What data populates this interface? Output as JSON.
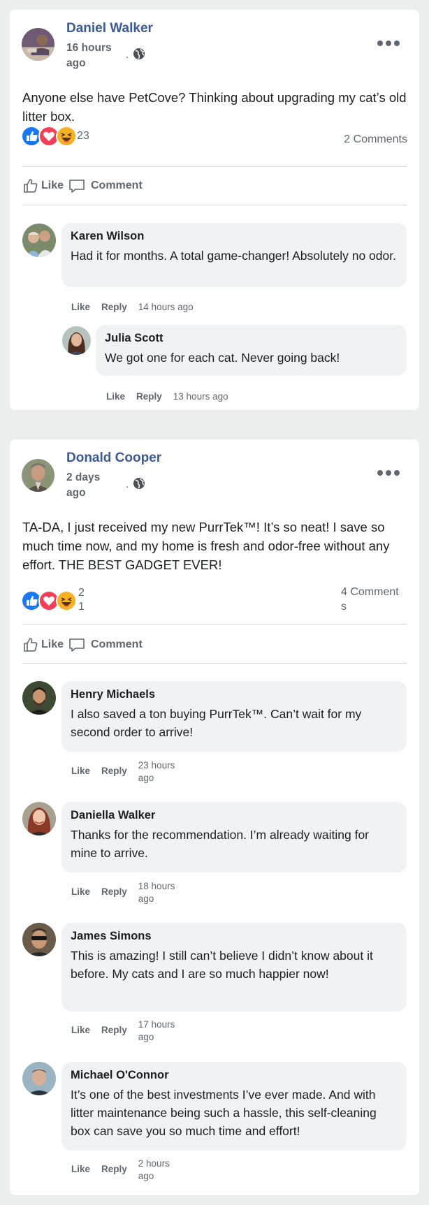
{
  "posts": [
    {
      "author": "Daniel Walker",
      "time": "16 hours ago",
      "separator": ".",
      "text": "Anyone else have PetCove? Thinking about upgrading my cat’s old litter box.",
      "reaction_count": "23",
      "comments_label": "2 Comments",
      "actions": {
        "like": "Like",
        "comment": "Comment"
      },
      "comments": [
        {
          "name": "Karen Wilson",
          "text": "Had it for months. A total game-changer! Absolutely no odor.",
          "like": "Like",
          "reply": "Reply",
          "time": "14 hours ago"
        },
        {
          "name": "Julia Scott",
          "text": "We got one for each cat. Never going back!",
          "like": "Like",
          "reply": "Reply",
          "time": "13 hours ago"
        }
      ]
    },
    {
      "author": "Donald Cooper",
      "time": "2 days ago",
      "separator": ".",
      "text": "TA-DA, I just received my new PurrTek™! It’s so neat! I save so much time now, and my home is fresh and odor-free without any effort. THE BEST GADGET EVER!",
      "reaction_count": "21",
      "comments_label": "4 Comments",
      "actions": {
        "like": "Like",
        "comment": "Comment"
      },
      "comments": [
        {
          "name": "Henry Michaels",
          "text": "I also saved a ton buying PurrTek™. Can’t wait for my second order to arrive!",
          "like": "Like",
          "reply": "Reply",
          "time": "23 hours ago"
        },
        {
          "name": "Daniella Walker",
          "text": "Thanks for the recommendation. I’m already waiting for mine to arrive.",
          "like": "Like",
          "reply": "Reply",
          "time": "18 hours ago"
        },
        {
          "name": "James Simons",
          "text": "This is amazing! I still can’t believe I didn’t know about it before. My cats and I are so much happier now!",
          "like": "Like",
          "reply": "Reply",
          "time": "17 hours ago"
        },
        {
          "name": "Michael O'Connor",
          "text": "It’s one of the best investments I’ve ever made. And with litter maintenance being such a hassle, this self-cleaning box can save you so much time and effort!",
          "like": "Like",
          "reply": "Reply",
          "time": "2 hours ago"
        }
      ]
    }
  ],
  "icons": {
    "like_reaction": "like-reaction-icon",
    "love_reaction": "love-reaction-icon",
    "haha_reaction": "haha-reaction-icon",
    "globe": "globe-icon",
    "more": "more-options-icon",
    "thumb": "thumbs-up-icon",
    "comment": "comment-bubble-icon"
  },
  "colors": {
    "author_name": "#3b5998",
    "like_blue": "#1877f2",
    "love_red": "#f33e58",
    "haha_yellow": "#f7b125",
    "meta_gray": "#606770",
    "bubble_bg": "#f0f2f5"
  }
}
